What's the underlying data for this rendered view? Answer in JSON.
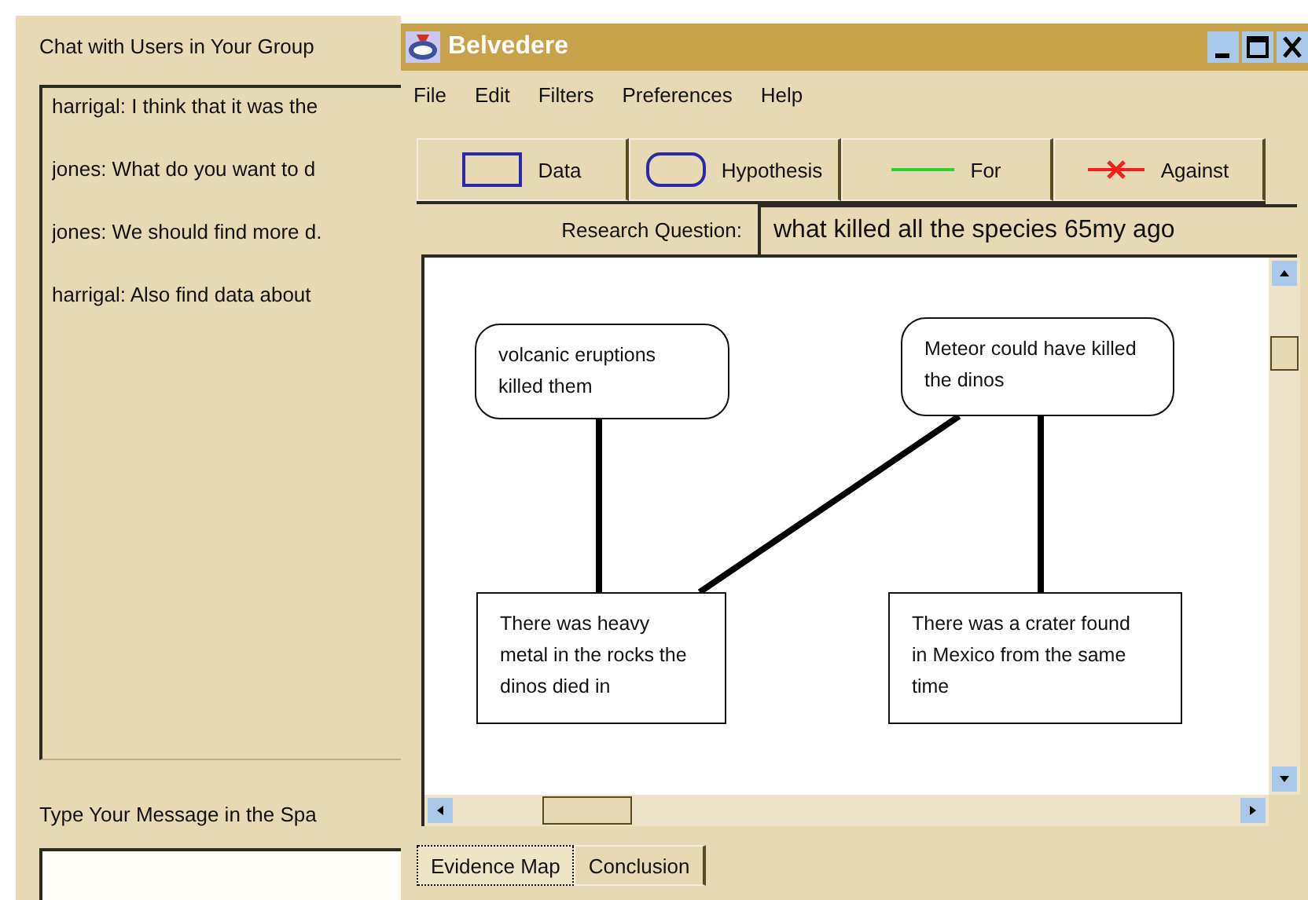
{
  "chat": {
    "title": "Chat with Users in Your Group",
    "messages": [
      "harrigal: I think that it was the",
      "jones: What do you want to d",
      "jones: We should find more d.",
      "harrigal: Also find data about"
    ],
    "prompt": "Type Your Message in the Spa"
  },
  "window": {
    "title": "Belvedere"
  },
  "menu": [
    "File",
    "Edit",
    "Filters",
    "Preferences",
    "Help"
  ],
  "toolbar": [
    {
      "kind": "data",
      "label": "Data"
    },
    {
      "kind": "hypothesis",
      "label": "Hypothesis"
    },
    {
      "kind": "for",
      "label": "For"
    },
    {
      "kind": "against",
      "label": "Against"
    }
  ],
  "research_question": {
    "label": "Research Question:",
    "value": "what killed all the species 65my ago"
  },
  "map": {
    "nodes": [
      {
        "kind": "hypothesis",
        "text": "volcanic eruptions killed them"
      },
      {
        "kind": "hypothesis",
        "text": "Meteor could have killed the dinos"
      },
      {
        "kind": "data",
        "text": "There was heavy metal in the rocks the dinos died in"
      },
      {
        "kind": "data",
        "text": "There was a crater found in Mexico from the same time"
      }
    ]
  },
  "tabs": [
    {
      "label": "Evidence Map",
      "selected": true
    },
    {
      "label": "Conclusion",
      "selected": false
    }
  ]
}
